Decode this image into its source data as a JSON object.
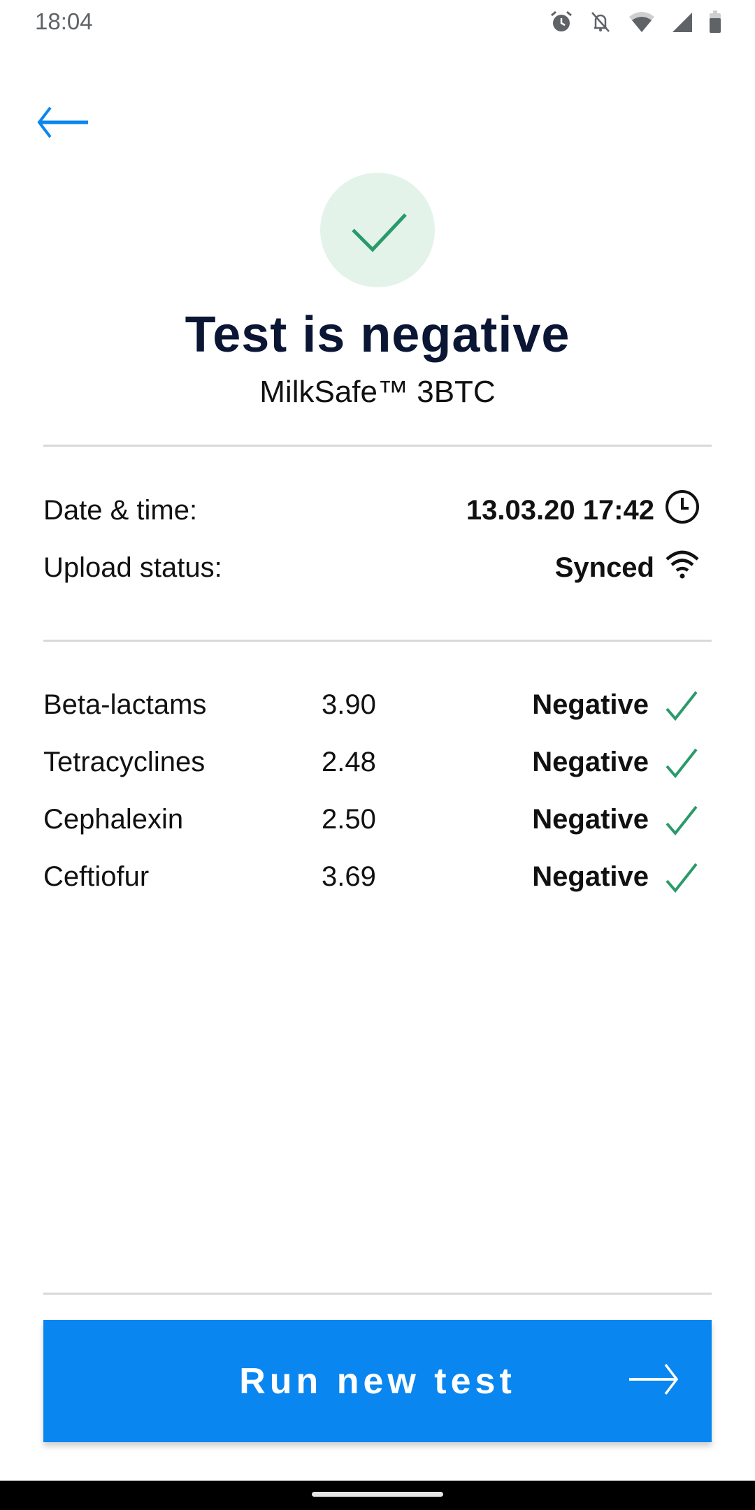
{
  "status_bar": {
    "time": "18:04",
    "icons": [
      "alarm-icon",
      "notifications-off-icon",
      "wifi-signal-icon",
      "cell-signal-icon",
      "battery-icon"
    ]
  },
  "header": {
    "back_icon": "arrow-left-icon"
  },
  "result": {
    "icon": "check-icon",
    "title": "Test is negative",
    "product": "MilkSafe™ 3BTC"
  },
  "info": [
    {
      "label": "Date & time:",
      "value": "13.03.20 17:42",
      "icon": "clock-icon"
    },
    {
      "label": "Upload status:",
      "value": "Synced",
      "icon": "wifi-icon"
    }
  ],
  "results": [
    {
      "name": "Beta-lactams",
      "value": "3.90",
      "status": "Negative"
    },
    {
      "name": "Tetracyclines",
      "value": "2.48",
      "status": "Negative"
    },
    {
      "name": "Cephalexin",
      "value": "2.50",
      "status": "Negative"
    },
    {
      "name": "Ceftiofur",
      "value": "3.69",
      "status": "Negative"
    }
  ],
  "actions": {
    "run_new_test_label": "Run new test",
    "run_new_test_icon": "arrow-right-icon"
  },
  "colors": {
    "accent": "#0a86f0",
    "success": "#2a9a6a",
    "success_bg": "#e3f3ea",
    "title": "#0a1633"
  }
}
